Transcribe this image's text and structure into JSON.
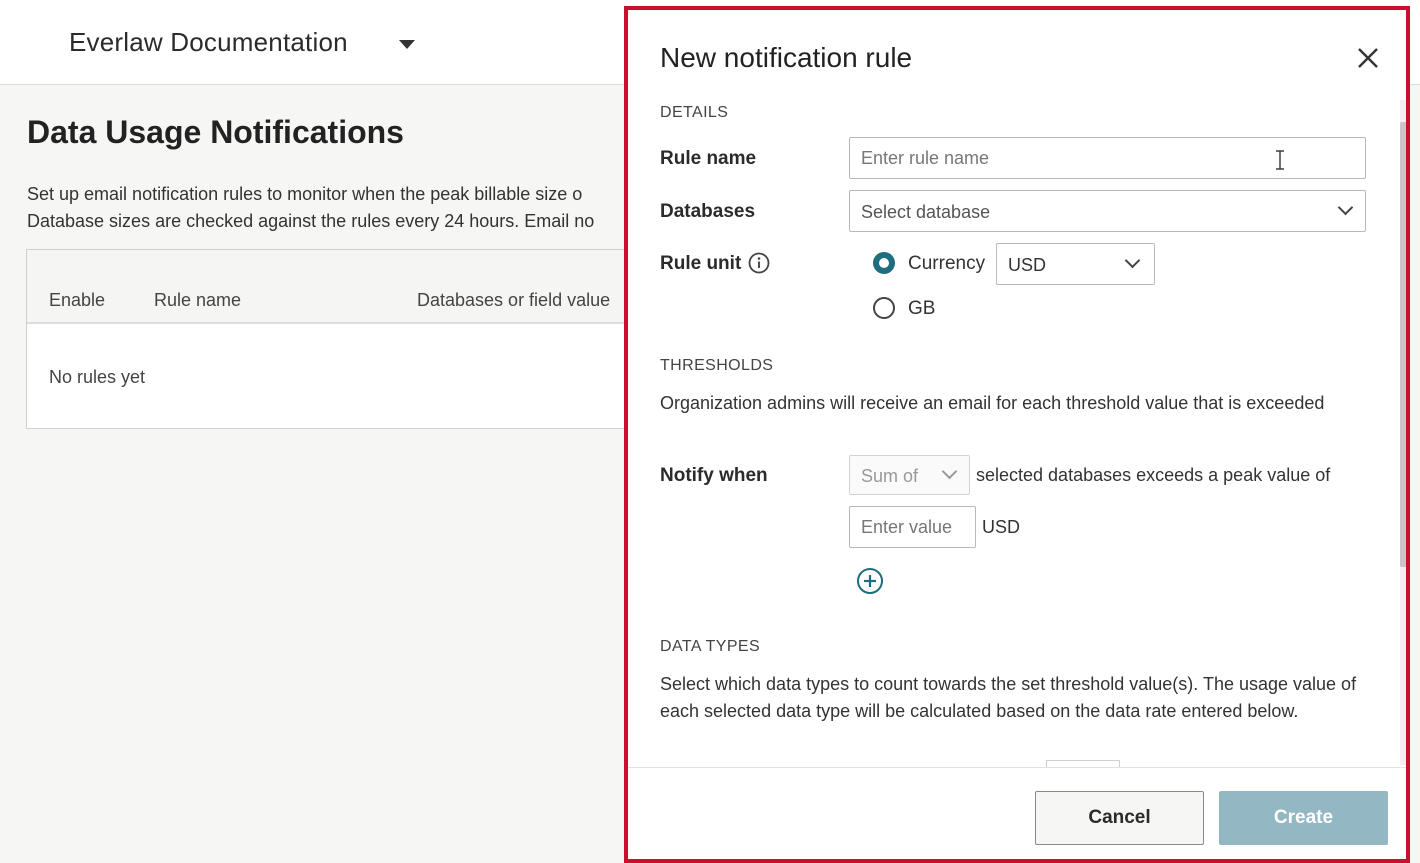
{
  "header": {
    "org_name": "Everlaw Documentation"
  },
  "page": {
    "title": "Data Usage Notifications",
    "desc_line1": "Set up email notification rules to monitor when the peak billable size o",
    "desc_line2": "Database sizes are checked against the rules every 24 hours. Email no"
  },
  "table": {
    "columns": [
      "Enable",
      "Rule name",
      "Databases or field value"
    ],
    "empty_message": "No rules yet"
  },
  "panel": {
    "title": "New notification rule",
    "details": {
      "section_label": "DETAILS",
      "rule_name_label": "Rule name",
      "rule_name_placeholder": "Enter rule name",
      "databases_label": "Databases",
      "databases_placeholder": "Select database",
      "rule_unit_label": "Rule unit",
      "unit_options": [
        {
          "label": "Currency",
          "checked": true
        },
        {
          "label": "GB",
          "checked": false
        }
      ],
      "currency_selected": "USD"
    },
    "thresholds": {
      "section_label": "THRESHOLDS",
      "description": "Organization admins will receive an email for each threshold value that is exceeded",
      "notify_label": "Notify when",
      "aggregate_selected": "Sum of",
      "condition_text": "selected databases exceeds a peak value of",
      "value_placeholder": "Enter value",
      "value_unit": "USD"
    },
    "data_types": {
      "section_label": "DATA TYPES",
      "description": "Select which data types to count towards the set threshold value(s). The usage value of each selected data type will be calculated based on the data rate entered below."
    },
    "footer": {
      "cancel_label": "Cancel",
      "create_label": "Create"
    }
  },
  "colors": {
    "accent": "#1f6e7d",
    "highlight_border": "#c8102e",
    "create_disabled": "#93b8c4"
  }
}
